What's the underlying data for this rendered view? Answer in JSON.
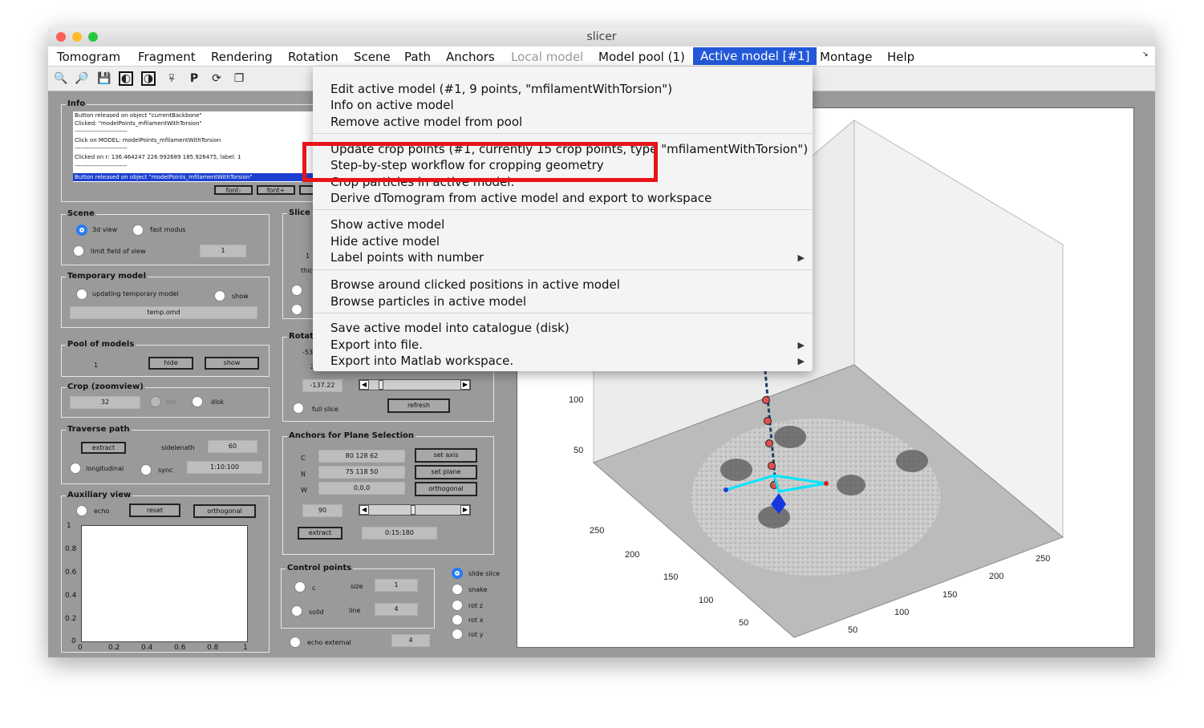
{
  "window": {
    "title": "slicer"
  },
  "menubar": {
    "items": [
      "Tomogram",
      "Fragment",
      "Rendering",
      "Rotation",
      "Scene",
      "Path",
      "Anchors",
      "Local model",
      "Model pool (1)",
      "Active model [#1]",
      "Montage",
      "Help"
    ],
    "active": "Active model [#1]",
    "disabled": "Local model"
  },
  "toolbar": {
    "icons": [
      "zoom-in-icon",
      "zoom-out-icon",
      "save-icon",
      "contrast-icon",
      "contrast-alt-icon",
      "pulse-icon",
      "p-icon",
      "rotate-icon",
      "copy-icon"
    ],
    "p_label": "P"
  },
  "dropdown": {
    "groups": [
      [
        "Edit active model (#1, 9 points, \"mfilamentWithTorsion\")",
        "Info on active model",
        "Remove active model from pool"
      ],
      [
        "Update crop points (#1, currently 15 crop points, type \"mfilamentWithTorsion\")",
        "Step-by-step workflow for cropping geometry",
        "Crop particles in active model.",
        "Derive dTomogram from active model and export to workspace"
      ],
      [
        "Show active model",
        "Hide active model",
        "Label points with number"
      ],
      [
        "Browse around clicked positions in active model",
        "Browse particles in active model"
      ],
      [
        "Save active model into catalogue (disk)",
        "Export into file.",
        "Export into Matlab workspace."
      ]
    ],
    "submenu_items": [
      "Label points with number",
      "Export into file.",
      "Export into Matlab workspace."
    ]
  },
  "info": {
    "title": "Info",
    "log": [
      "Button released on object \"currentBackbone\"",
      "Clicked: \"modelPoints_mfilamentWithTorsion\"",
      "--------------------------",
      "Click on MODEL: modelPoints_mfilamentWithTorsion",
      "--------------------------",
      "Clicked on  r: 136.464247 226.992689 185.926475, label: 1",
      "--------------------------",
      "Button released on object \"modelPoints_mfilamentWithTorsion\""
    ],
    "font_minus": "font-",
    "font_plus": "font+"
  },
  "scene": {
    "title": "Scene",
    "view3d": "3d view",
    "fast": "fast modus",
    "limit": "limit field of view",
    "limit_value": "1"
  },
  "temporary_model": {
    "title": "Temporary model",
    "updating": "updating temporary model",
    "show": "show",
    "file": "temp.omd"
  },
  "pool": {
    "title": "Pool of models",
    "value": "1",
    "hide": "hide",
    "show": "show"
  },
  "crop": {
    "title": "Crop (zoomview)",
    "value": "32",
    "bin": "bin",
    "disk": "disk"
  },
  "traverse": {
    "title": "Traverse path",
    "extract": "extract",
    "sidelength_label": "sidelenath",
    "sidelength": "60",
    "longitudinal": "longitudinal",
    "sync": "sync",
    "range": "1:10:100"
  },
  "aux": {
    "title": "Auxiliary view",
    "echo": "echo",
    "reset": "reset",
    "orthogonal": "orthogonal",
    "yticks": [
      "1",
      "0.8",
      "0.6",
      "0.4",
      "0.2",
      "0"
    ],
    "xticks": [
      "0",
      "0.2",
      "0.4",
      "0.6",
      "0.8",
      "1"
    ]
  },
  "slice": {
    "title": "Slice",
    "row1": "1",
    "thick": "thic"
  },
  "rotation": {
    "title": "Rotati",
    "value1": "-53",
    "value2": "2",
    "angle": "-137.22",
    "full_slice": "full slice",
    "refresh": "refresh"
  },
  "anchors": {
    "title": "Anchors for Plane Selection",
    "c_label": "C",
    "c_value": "80 128 62",
    "n_label": "N",
    "n_value": "75 118 50",
    "w_label": "W",
    "w_value": "0,0,0",
    "set_axis": "set axis",
    "set_plane": "set plane",
    "orthogonal": "orthogonal",
    "angle": "90",
    "extract": "extract",
    "range": "0:15:180"
  },
  "control_points": {
    "title": "Control points",
    "c": "c",
    "solid": "solid",
    "size_label": "size",
    "size": "1",
    "line_label": "line",
    "line": "4",
    "echo_external": "echo external",
    "echo_value": "4"
  },
  "modes": {
    "items": [
      "slide slice",
      "snake",
      "rot z",
      "rot x",
      "rot y"
    ],
    "selected": "slide slice"
  },
  "plot3d": {
    "z_ticks": [
      "100",
      "50"
    ],
    "left_ticks": [
      "250",
      "200",
      "150",
      "100",
      "50"
    ],
    "right_ticks": [
      "250",
      "200",
      "150",
      "100",
      "50"
    ]
  },
  "colors": {
    "accent": "#2359d9",
    "highlight": "#e8141b",
    "model_line": "#00e5ff",
    "marker": "#e05050"
  }
}
